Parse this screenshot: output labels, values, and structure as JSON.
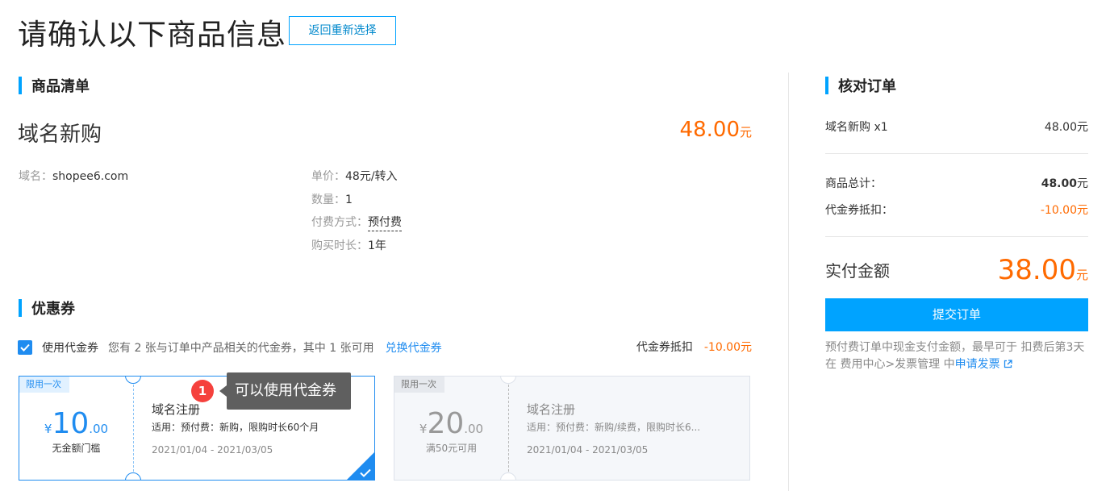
{
  "page": {
    "title": "请确认以下商品信息",
    "back_label": "返回重新选择"
  },
  "goods": {
    "section_title": "商品清单",
    "product_name": "域名新购",
    "price": "48.00",
    "price_unit": "元",
    "domain_label": "域名：",
    "domain_value": "shopee6.com",
    "unit_price_label": "单价：",
    "unit_price_value": "48元/转入",
    "quantity_label": "数量：",
    "quantity_value": "1",
    "pay_method_label": "付费方式：",
    "pay_method_value": "预付费",
    "duration_label": "购买时长：",
    "duration_value": "1年"
  },
  "coupons": {
    "section_title": "优惠券",
    "use_checked": true,
    "use_label": "使用代金券",
    "desc": "您有 2 张与订单中产品相关的代金券，其中 1 张可用",
    "exchange_link": "兑换代金券",
    "deduct_label": "代金券抵扣",
    "deduct_value": "-10.00元",
    "tooltip_badge": "1",
    "tooltip_text": "可以使用代金券",
    "items": [
      {
        "tag": "限用一次",
        "symbol": "¥",
        "amount_int": "10",
        "amount_dec": ".00",
        "condition": "无金额门槛",
        "name": "域名注册",
        "scope": "适用：预付费：新购，限购时长60个月",
        "date": "2021/01/04 - 2021/03/05",
        "selected": true
      },
      {
        "tag": "限用一次",
        "symbol": "¥",
        "amount_int": "20",
        "amount_dec": ".00",
        "condition": "满50元可用",
        "name": "域名注册",
        "scope": "适用：预付费：新购/续费，限购时长6...",
        "date": "2021/01/04 - 2021/03/05",
        "selected": false
      }
    ]
  },
  "order": {
    "section_title": "核对订单",
    "item_label": "域名新购 x1",
    "item_value": "48.00元",
    "total_label": "商品总计：",
    "total_value_num": "48.00",
    "total_value_unit": "元",
    "coupon_label": "代金券抵扣：",
    "coupon_value": "-10.00元",
    "pay_label": "实付金额",
    "pay_value": "38.00",
    "pay_unit": "元",
    "submit_label": "提交订单",
    "note_text": "预付费订单中现金支付金额，最早可于 扣费后第3天 在 费用中心>发票管理 中",
    "note_link": "申请发票"
  },
  "colors": {
    "accent": "#00a3ff",
    "price": "#ff6a00",
    "link": "#1f8cf0"
  }
}
